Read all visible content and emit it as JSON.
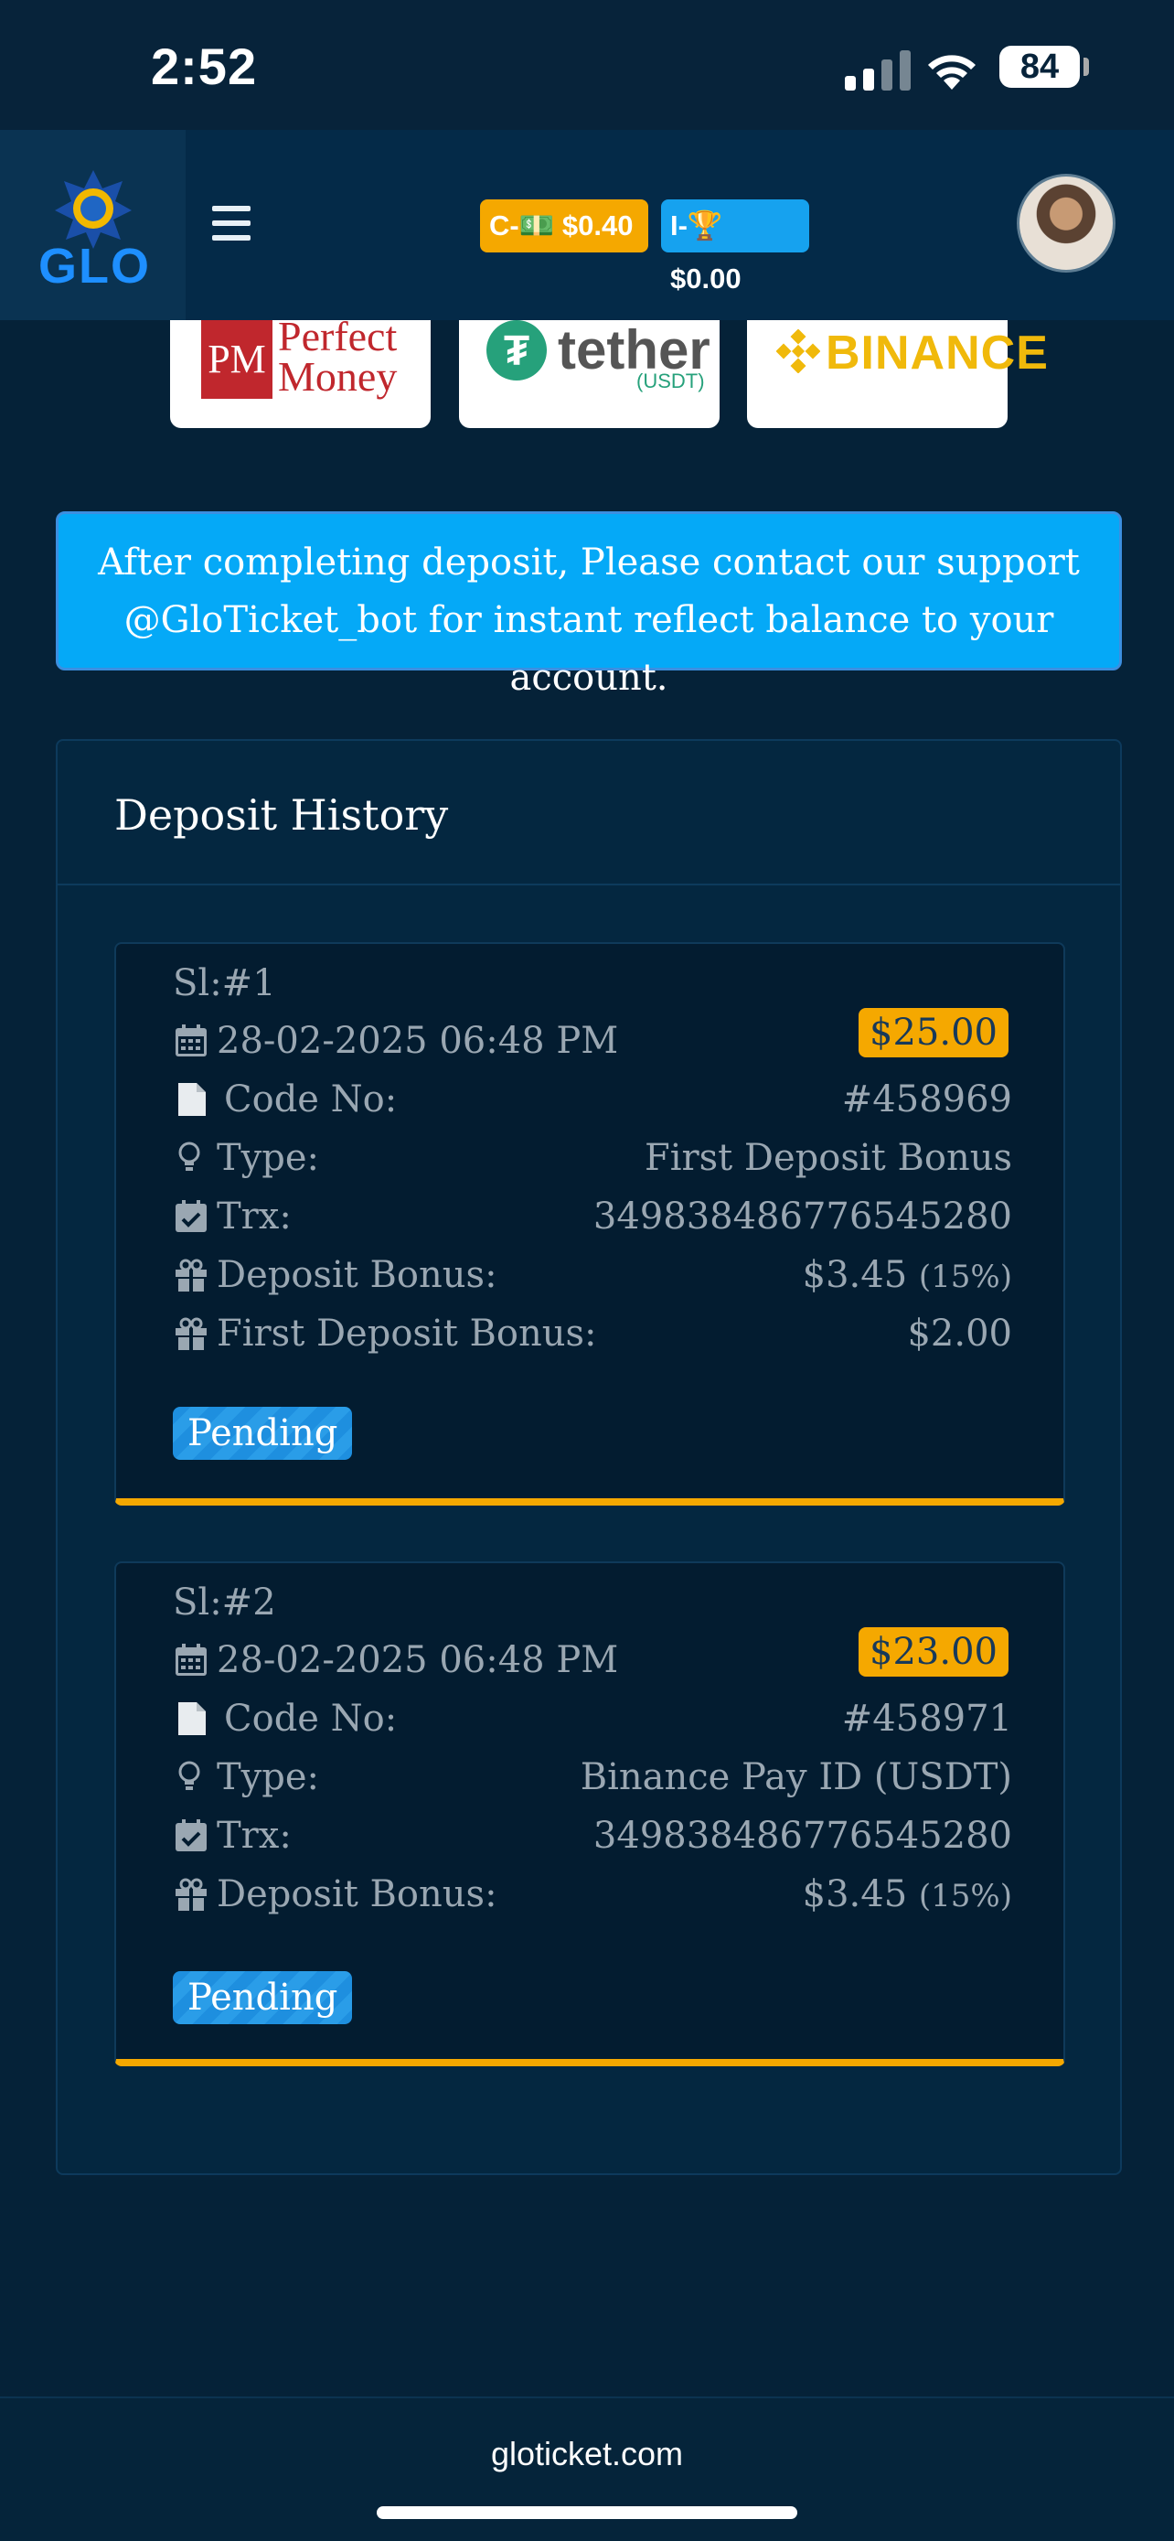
{
  "status_bar": {
    "time": "2:52",
    "battery": "84"
  },
  "header": {
    "logo_text": "GLO",
    "c_balance": "C-💵 $0.40",
    "i_balance": "I-🏆 $0.00"
  },
  "payment_methods": {
    "perfect_money_mark": "PM",
    "perfect_money_line1": "Perfect",
    "perfect_money_line2": "Money",
    "tether": "tether",
    "tether_sub": "(USDT)",
    "binance": "BINANCE"
  },
  "notice": {
    "line1": "After completing deposit, Please contact our support",
    "line2": "@GloTicket_bot for instant reflect balance to your account."
  },
  "history": {
    "title": "Deposit History",
    "deposits": [
      {
        "sl": "Sl:#1",
        "date": "28-02-2025 06:48 PM",
        "amount": "$25.00",
        "code_label": "Code No:",
        "code": "#458969",
        "type_label": "Type:",
        "type": "First Deposit Bonus",
        "trx_label": "Trx:",
        "trx": "349838486776545280",
        "bonus_label": "Deposit Bonus:",
        "bonus": "$3.45",
        "bonus_pct": "(15%)",
        "first_bonus_label": "First Deposit Bonus:",
        "first_bonus": "$2.00",
        "status": "Pending"
      },
      {
        "sl": "Sl:#2",
        "date": "28-02-2025 06:48 PM",
        "amount": "$23.00",
        "code_label": "Code No:",
        "code": "#458971",
        "type_label": "Type:",
        "type": "Binance Pay ID (USDT)",
        "trx_label": "Trx:",
        "trx": "349838486776545280",
        "bonus_label": "Deposit Bonus:",
        "bonus": "$3.45",
        "bonus_pct": "(15%)",
        "status": "Pending"
      }
    ]
  },
  "footer": {
    "url": "gloticket.com"
  },
  "colors": {
    "background": "#052238",
    "accent_orange": "#f5a800",
    "accent_blue": "#05a9f7"
  }
}
